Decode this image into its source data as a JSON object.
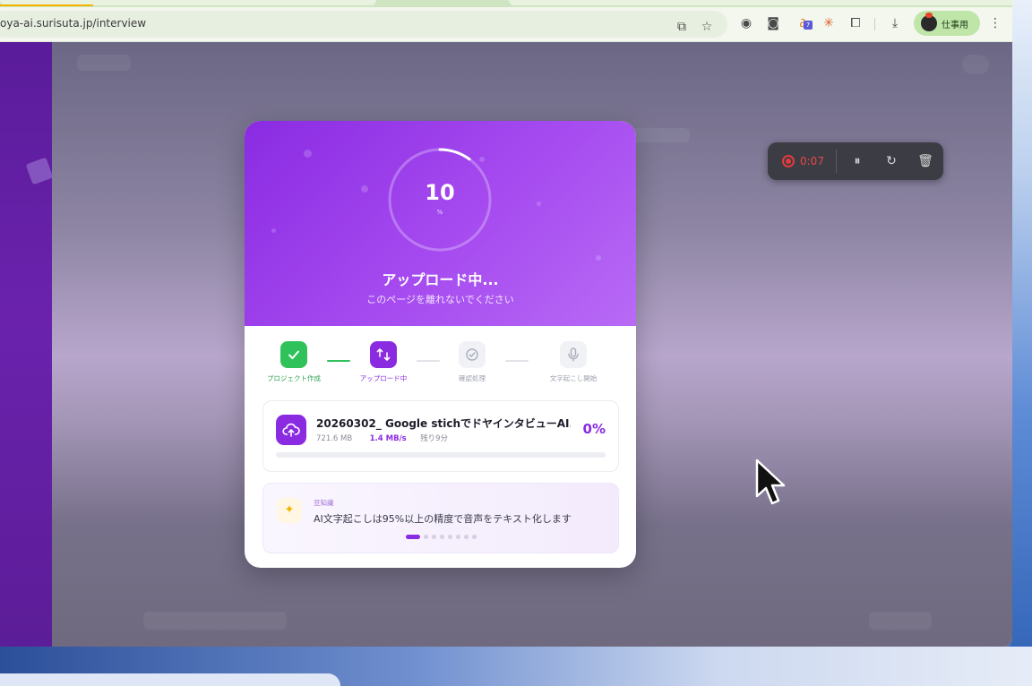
{
  "browser": {
    "url": "oya-ai.surisuta.jp/interview",
    "profile_label": "仕事用",
    "toolbar_icons": [
      "install-app-icon",
      "star-icon",
      "extension-icon",
      "camera-icon",
      "extension-badge-icon",
      "sparkle-icon",
      "puzzle-icon",
      "download-icon"
    ],
    "extension_badge": "7",
    "menu_icon": "kebab-menu-icon"
  },
  "recorder": {
    "time": "0:07",
    "color": "#e33b3b"
  },
  "upload_modal": {
    "progress_value": "10",
    "progress_unit": "%",
    "progress_fraction": 0.1,
    "title": "アップロード中...",
    "subtitle": "このページを離れないでください",
    "accent_color": "#8a2be2",
    "steps": [
      {
        "label": "プロジェクト作成",
        "state": "done"
      },
      {
        "label": "アップロード中",
        "state": "active"
      },
      {
        "label": "確認処理",
        "state": "pending"
      },
      {
        "label": "文字起こし開始",
        "state": "pending"
      }
    ],
    "file": {
      "name": "20260302_ Google stichでドヤインタビューAI...",
      "size": "721.6 MB",
      "speed": "1.4 MB/s",
      "remaining": "残り9分",
      "percent": "0%",
      "bar_fraction": 0.0
    },
    "tip": {
      "label": "豆知識",
      "text": "AI文字起こしは95%以上の精度で音声をテキスト化します",
      "dot_count": 8,
      "active_dot": 0
    }
  }
}
